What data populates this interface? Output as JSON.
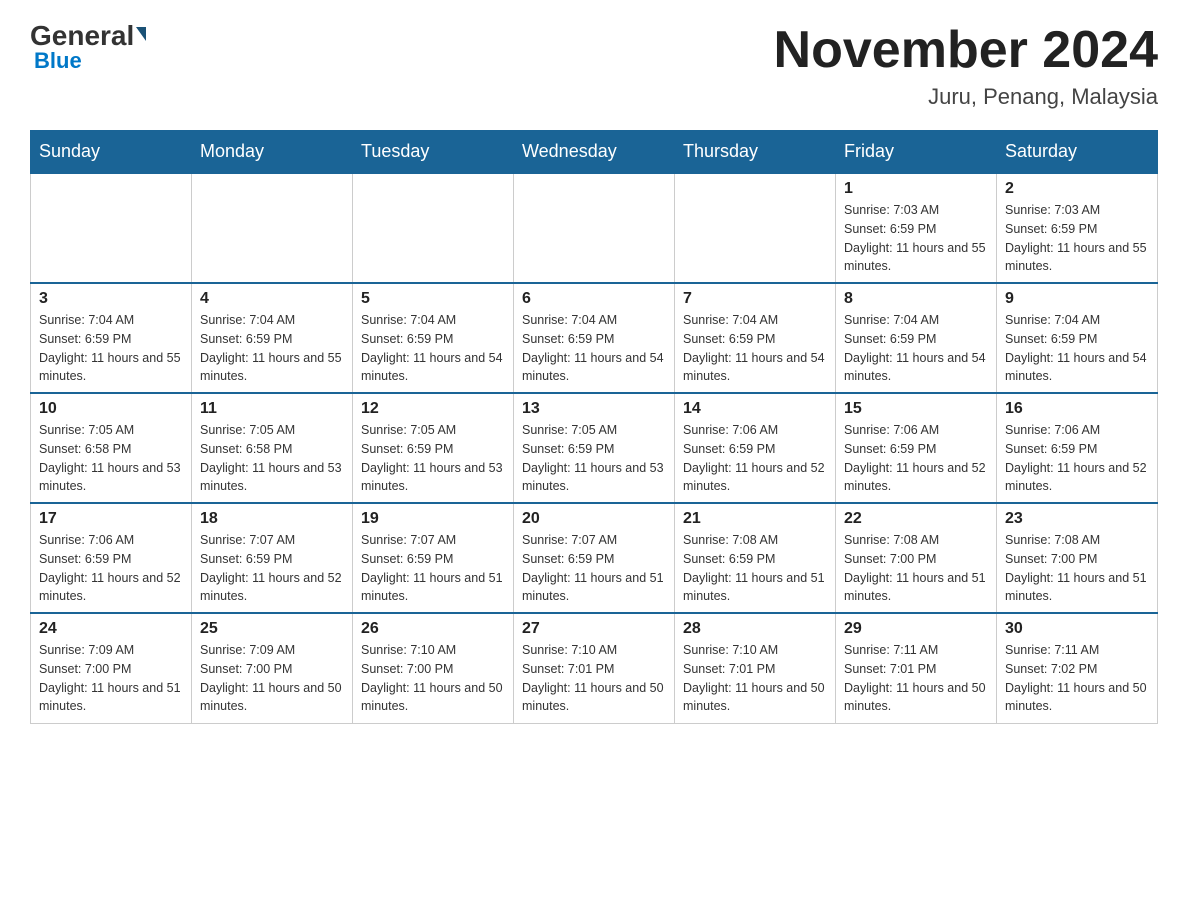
{
  "logo": {
    "general_text": "General",
    "blue_text": "Blue"
  },
  "title": "November 2024",
  "subtitle": "Juru, Penang, Malaysia",
  "days_of_week": [
    "Sunday",
    "Monday",
    "Tuesday",
    "Wednesday",
    "Thursday",
    "Friday",
    "Saturday"
  ],
  "weeks": [
    [
      {
        "day": "",
        "info": ""
      },
      {
        "day": "",
        "info": ""
      },
      {
        "day": "",
        "info": ""
      },
      {
        "day": "",
        "info": ""
      },
      {
        "day": "",
        "info": ""
      },
      {
        "day": "1",
        "info": "Sunrise: 7:03 AM\nSunset: 6:59 PM\nDaylight: 11 hours and 55 minutes."
      },
      {
        "day": "2",
        "info": "Sunrise: 7:03 AM\nSunset: 6:59 PM\nDaylight: 11 hours and 55 minutes."
      }
    ],
    [
      {
        "day": "3",
        "info": "Sunrise: 7:04 AM\nSunset: 6:59 PM\nDaylight: 11 hours and 55 minutes."
      },
      {
        "day": "4",
        "info": "Sunrise: 7:04 AM\nSunset: 6:59 PM\nDaylight: 11 hours and 55 minutes."
      },
      {
        "day": "5",
        "info": "Sunrise: 7:04 AM\nSunset: 6:59 PM\nDaylight: 11 hours and 54 minutes."
      },
      {
        "day": "6",
        "info": "Sunrise: 7:04 AM\nSunset: 6:59 PM\nDaylight: 11 hours and 54 minutes."
      },
      {
        "day": "7",
        "info": "Sunrise: 7:04 AM\nSunset: 6:59 PM\nDaylight: 11 hours and 54 minutes."
      },
      {
        "day": "8",
        "info": "Sunrise: 7:04 AM\nSunset: 6:59 PM\nDaylight: 11 hours and 54 minutes."
      },
      {
        "day": "9",
        "info": "Sunrise: 7:04 AM\nSunset: 6:59 PM\nDaylight: 11 hours and 54 minutes."
      }
    ],
    [
      {
        "day": "10",
        "info": "Sunrise: 7:05 AM\nSunset: 6:58 PM\nDaylight: 11 hours and 53 minutes."
      },
      {
        "day": "11",
        "info": "Sunrise: 7:05 AM\nSunset: 6:58 PM\nDaylight: 11 hours and 53 minutes."
      },
      {
        "day": "12",
        "info": "Sunrise: 7:05 AM\nSunset: 6:59 PM\nDaylight: 11 hours and 53 minutes."
      },
      {
        "day": "13",
        "info": "Sunrise: 7:05 AM\nSunset: 6:59 PM\nDaylight: 11 hours and 53 minutes."
      },
      {
        "day": "14",
        "info": "Sunrise: 7:06 AM\nSunset: 6:59 PM\nDaylight: 11 hours and 52 minutes."
      },
      {
        "day": "15",
        "info": "Sunrise: 7:06 AM\nSunset: 6:59 PM\nDaylight: 11 hours and 52 minutes."
      },
      {
        "day": "16",
        "info": "Sunrise: 7:06 AM\nSunset: 6:59 PM\nDaylight: 11 hours and 52 minutes."
      }
    ],
    [
      {
        "day": "17",
        "info": "Sunrise: 7:06 AM\nSunset: 6:59 PM\nDaylight: 11 hours and 52 minutes."
      },
      {
        "day": "18",
        "info": "Sunrise: 7:07 AM\nSunset: 6:59 PM\nDaylight: 11 hours and 52 minutes."
      },
      {
        "day": "19",
        "info": "Sunrise: 7:07 AM\nSunset: 6:59 PM\nDaylight: 11 hours and 51 minutes."
      },
      {
        "day": "20",
        "info": "Sunrise: 7:07 AM\nSunset: 6:59 PM\nDaylight: 11 hours and 51 minutes."
      },
      {
        "day": "21",
        "info": "Sunrise: 7:08 AM\nSunset: 6:59 PM\nDaylight: 11 hours and 51 minutes."
      },
      {
        "day": "22",
        "info": "Sunrise: 7:08 AM\nSunset: 7:00 PM\nDaylight: 11 hours and 51 minutes."
      },
      {
        "day": "23",
        "info": "Sunrise: 7:08 AM\nSunset: 7:00 PM\nDaylight: 11 hours and 51 minutes."
      }
    ],
    [
      {
        "day": "24",
        "info": "Sunrise: 7:09 AM\nSunset: 7:00 PM\nDaylight: 11 hours and 51 minutes."
      },
      {
        "day": "25",
        "info": "Sunrise: 7:09 AM\nSunset: 7:00 PM\nDaylight: 11 hours and 50 minutes."
      },
      {
        "day": "26",
        "info": "Sunrise: 7:10 AM\nSunset: 7:00 PM\nDaylight: 11 hours and 50 minutes."
      },
      {
        "day": "27",
        "info": "Sunrise: 7:10 AM\nSunset: 7:01 PM\nDaylight: 11 hours and 50 minutes."
      },
      {
        "day": "28",
        "info": "Sunrise: 7:10 AM\nSunset: 7:01 PM\nDaylight: 11 hours and 50 minutes."
      },
      {
        "day": "29",
        "info": "Sunrise: 7:11 AM\nSunset: 7:01 PM\nDaylight: 11 hours and 50 minutes."
      },
      {
        "day": "30",
        "info": "Sunrise: 7:11 AM\nSunset: 7:02 PM\nDaylight: 11 hours and 50 minutes."
      }
    ]
  ]
}
